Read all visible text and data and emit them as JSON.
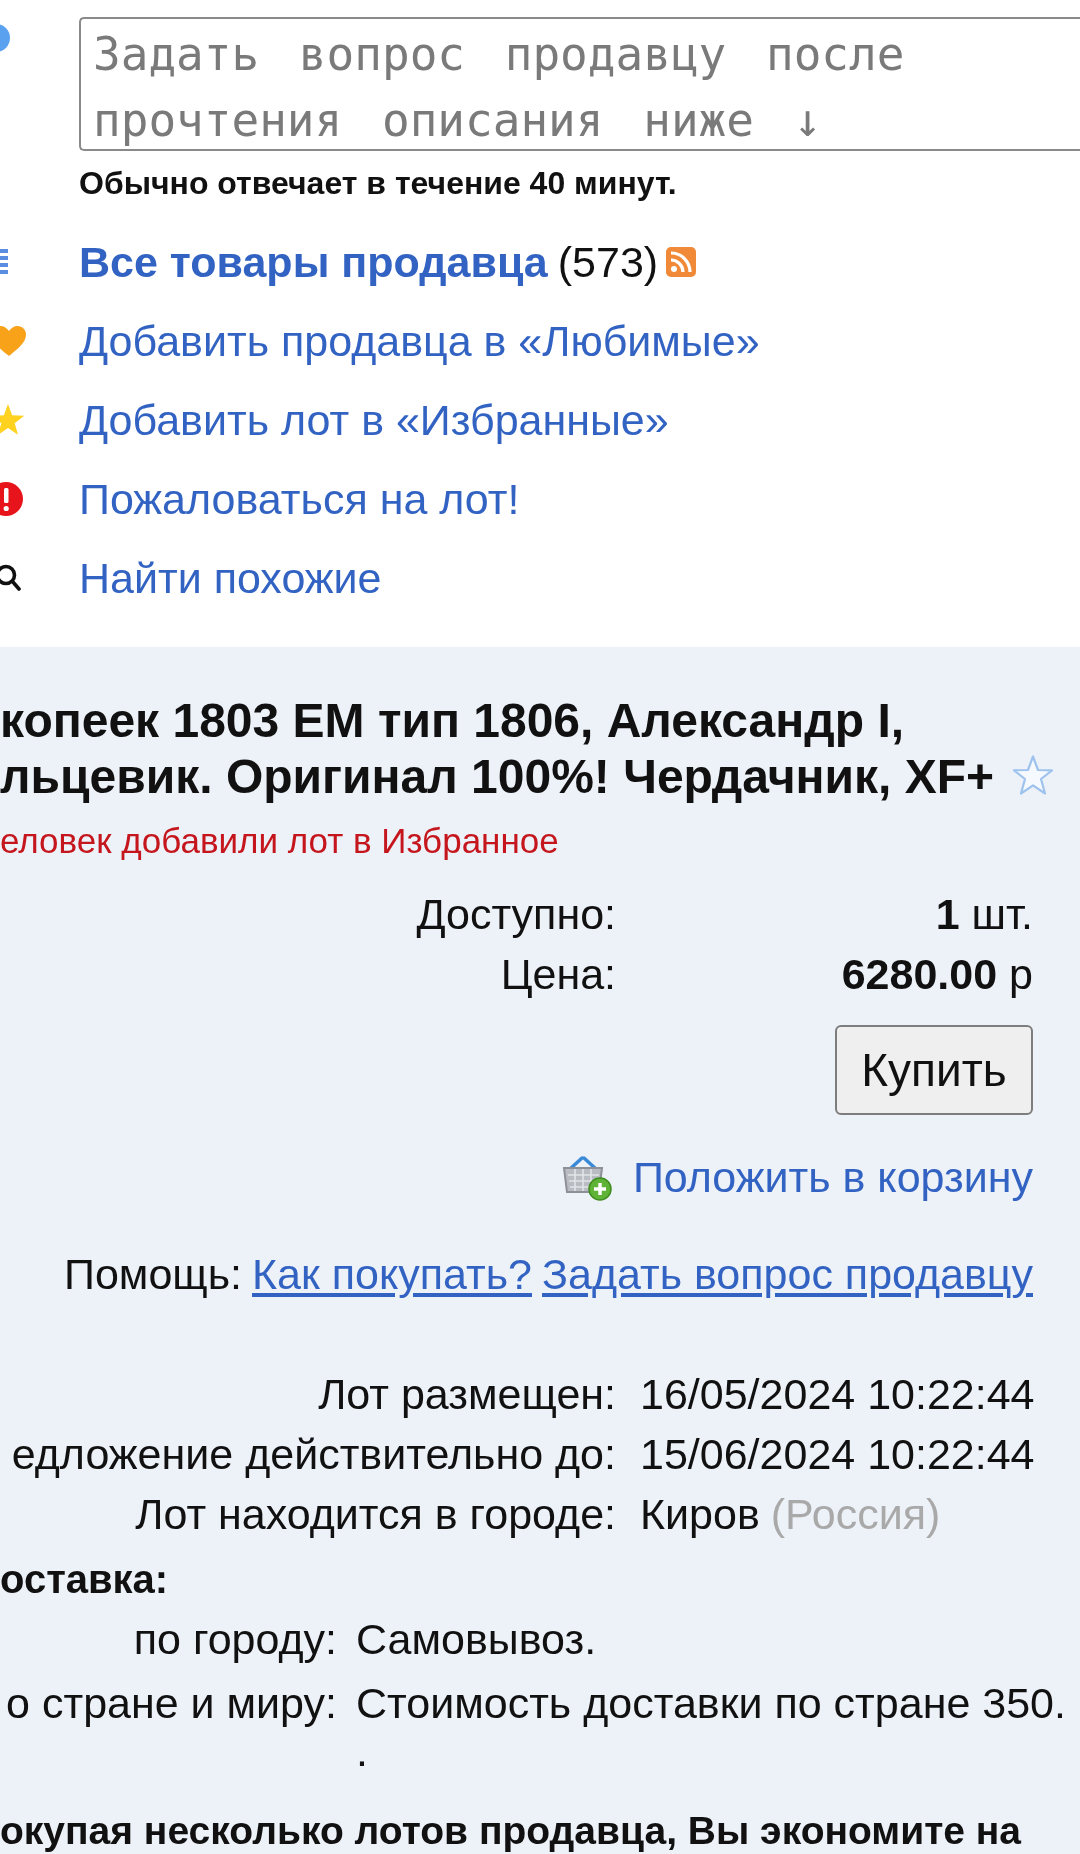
{
  "question_box": {
    "placeholder": "Задать вопрос продавцу после прочтения описания ниже ↓"
  },
  "reply_note": "Обычно отвечает в течение 40 минут.",
  "seller_links": [
    {
      "kind": "all_items",
      "label": "Все товары продавца",
      "count": "(573)"
    },
    {
      "kind": "favorite_seller",
      "label": "Добавить продавца в «Любимые»"
    },
    {
      "kind": "favorite_lot",
      "label": "Добавить лот в «Избранные»"
    },
    {
      "kind": "report",
      "label": "Пожаловаться на лот!"
    },
    {
      "kind": "similar",
      "label": "Найти похожие"
    }
  ],
  "lot": {
    "title_lines": [
      "копеек 1803 ЕМ тип 1806, Александр I,",
      "льцевик. Оригинал 100%! Чердачник, XF+"
    ],
    "favorited": false,
    "watchers_note": "еловек добавили лот в Избранное",
    "offer": [
      {
        "label": "Доступно:",
        "value": "**1** шт."
      },
      {
        "label": "Цена:",
        "value": "**6280.00** р"
      }
    ],
    "buy_button": "Купить",
    "cart_link": "Положить в корзину",
    "help": {
      "label": "Помощь:",
      "links": [
        "Как покупать?",
        "Задать вопрос продавцу"
      ]
    },
    "details": [
      {
        "label": "Лот размещен:",
        "value": "16/05/2024 10:22:44"
      },
      {
        "label": "едложение действительно до:",
        "value": "15/06/2024 10:22:44"
      },
      {
        "label": "Лот находится в городе:",
        "value": "Киров",
        "note": "(Россия)"
      }
    ],
    "delivery": {
      "title": "оставка:",
      "rows": [
        {
          "label": "по городу:",
          "value_lines": [
            "Самовывоз."
          ]
        },
        {
          "label": "о стране и миру:",
          "value_lines": [
            "Стоимость доставки по стране 350.",
            "."
          ]
        }
      ]
    },
    "footer_note": "окупая несколько лотов продавца, Вы экономите на"
  }
}
